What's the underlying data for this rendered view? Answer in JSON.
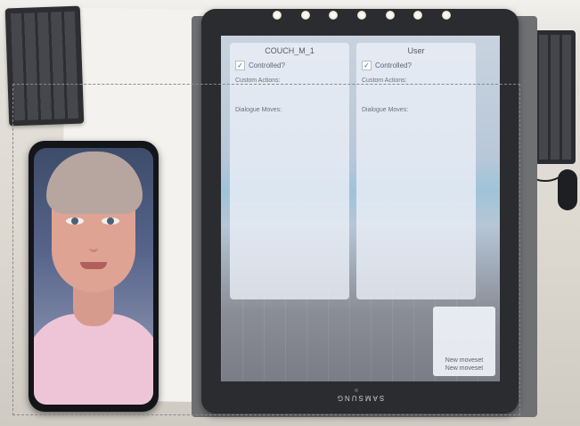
{
  "tablet": {
    "brand_text": "SAMSUNG",
    "left_panel": {
      "title": "COUCH_M_1",
      "checkbox_mark": "✓",
      "controlled_label": "Controlled?",
      "custom_actions_label": "Custom Actions:",
      "dialogue_moves_label": "Dialogue Moves:"
    },
    "right_panel": {
      "title": "User",
      "checkbox_mark": "✓",
      "controlled_label": "Controlled?",
      "custom_actions_label": "Custom Actions:",
      "dialogue_moves_label": "Dialogue Moves:"
    },
    "moveset_panel": {
      "items": [
        "New moveset",
        "New moveset"
      ]
    }
  },
  "colors": {
    "panel_bg": "#eceff7",
    "screen_accent": "#9fc3d9",
    "shirt": "#eec5d6",
    "device_frame": "#2b2c2f"
  }
}
